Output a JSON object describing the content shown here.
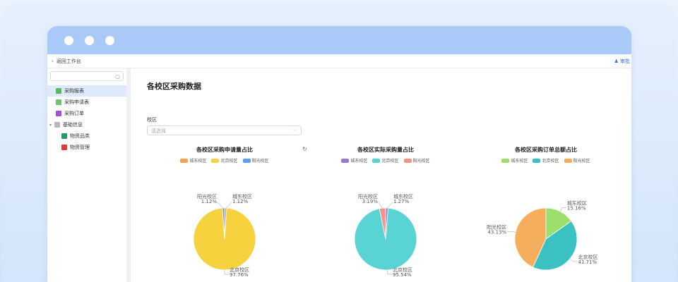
{
  "nav": {
    "back": "返回工作台",
    "user": "审批"
  },
  "sidebar": {
    "search_placeholder": "",
    "items": [
      {
        "label": "采购报表",
        "color": "#5cb85c",
        "selected": true,
        "level": 0
      },
      {
        "label": "采购申请表",
        "color": "#6fc36f",
        "selected": false,
        "level": 0
      },
      {
        "label": "采购订单",
        "color": "#a94bd8",
        "selected": false,
        "level": 0
      },
      {
        "label": "基础信息",
        "color": "#b9b9b9",
        "selected": false,
        "level": 0,
        "group": true
      },
      {
        "label": "物资品类",
        "color": "#1f9b6e",
        "selected": false,
        "level": 1
      },
      {
        "label": "物资管理",
        "color": "#e03a3a",
        "selected": false,
        "level": 1
      }
    ]
  },
  "page": {
    "title": "各校区采购数据",
    "filter_label": "校区",
    "filter_placeholder": "请选择"
  },
  "chart_data": [
    {
      "type": "pie",
      "title": "各校区采购申请量占比",
      "legend": [
        "城东校区",
        "北京校区",
        "阳光校区"
      ],
      "colors": [
        "#f7a24a",
        "#f7d23f",
        "#5b9ef5"
      ],
      "slices": [
        {
          "name": "城东校区",
          "value": 1.12,
          "label": "1.12%"
        },
        {
          "name": "北京校区",
          "value": 97.76,
          "label": "97.76%"
        },
        {
          "name": "阳光校区",
          "value": 1.12,
          "label": "1.12%"
        }
      ]
    },
    {
      "type": "pie",
      "title": "各校区实际采购量占比",
      "legend": [
        "城东校区",
        "北京校区",
        "阳光校区"
      ],
      "colors": [
        "#9b78cf",
        "#5ad3d5",
        "#f3948b"
      ],
      "slices": [
        {
          "name": "城东校区",
          "value": 1.27,
          "label": "1.27%"
        },
        {
          "name": "北京校区",
          "value": 95.54,
          "label": "95.54%"
        },
        {
          "name": "阳光校区",
          "value": 3.19,
          "label": "3.19%"
        }
      ]
    },
    {
      "type": "pie",
      "title": "各校区采购订单总额占比",
      "legend": [
        "城东校区",
        "北京校区",
        "阳光校区"
      ],
      "colors": [
        "#9be06c",
        "#3cc1c3",
        "#f4ae5c"
      ],
      "slices": [
        {
          "name": "城东校区",
          "value": 15.16,
          "label": "15.16%"
        },
        {
          "name": "北京校区",
          "value": 41.71,
          "label": "41.71%"
        },
        {
          "name": "阳光校区",
          "value": 43.13,
          "label": "43.13%"
        }
      ]
    }
  ]
}
